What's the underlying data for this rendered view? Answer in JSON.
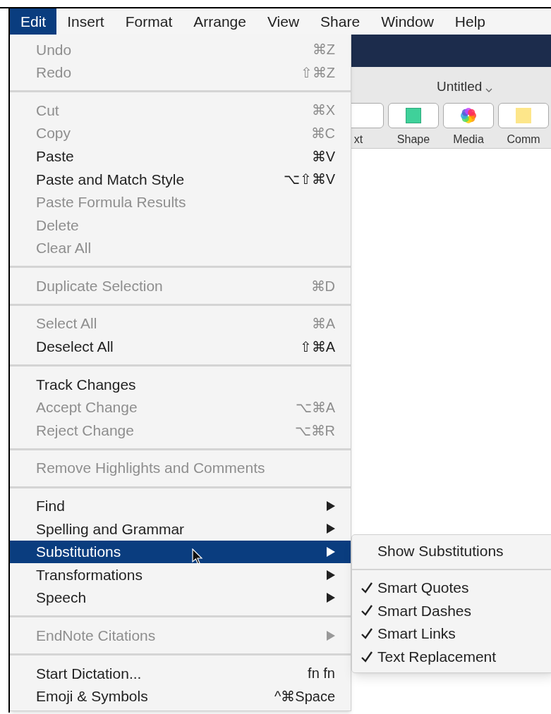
{
  "menubar": [
    {
      "label": "Edit",
      "selected": true
    },
    {
      "label": "Insert",
      "selected": false
    },
    {
      "label": "Format",
      "selected": false
    },
    {
      "label": "Arrange",
      "selected": false
    },
    {
      "label": "View",
      "selected": false
    },
    {
      "label": "Share",
      "selected": false
    },
    {
      "label": "Window",
      "selected": false
    },
    {
      "label": "Help",
      "selected": false
    }
  ],
  "window": {
    "title": "Untitled",
    "toolbar": [
      {
        "kind": "text",
        "label": "xt"
      },
      {
        "kind": "shape",
        "label": "Shape"
      },
      {
        "kind": "media",
        "label": "Media"
      },
      {
        "kind": "comment",
        "label": "Comm"
      }
    ]
  },
  "menu": {
    "sections": [
      [
        {
          "label": "Undo",
          "shortcut": "⌘Z",
          "disabled": true,
          "submenu": false,
          "selected": false
        },
        {
          "label": "Redo",
          "shortcut": "⇧⌘Z",
          "disabled": true,
          "submenu": false,
          "selected": false
        }
      ],
      [
        {
          "label": "Cut",
          "shortcut": "⌘X",
          "disabled": true,
          "submenu": false,
          "selected": false
        },
        {
          "label": "Copy",
          "shortcut": "⌘C",
          "disabled": true,
          "submenu": false,
          "selected": false
        },
        {
          "label": "Paste",
          "shortcut": "⌘V",
          "disabled": false,
          "submenu": false,
          "selected": false
        },
        {
          "label": "Paste and Match Style",
          "shortcut": "⌥⇧⌘V",
          "disabled": false,
          "submenu": false,
          "selected": false
        },
        {
          "label": "Paste Formula Results",
          "disabled": true,
          "submenu": false,
          "selected": false
        },
        {
          "label": "Delete",
          "disabled": true,
          "submenu": false,
          "selected": false
        },
        {
          "label": "Clear All",
          "disabled": true,
          "submenu": false,
          "selected": false
        }
      ],
      [
        {
          "label": "Duplicate Selection",
          "shortcut": "⌘D",
          "disabled": true,
          "submenu": false,
          "selected": false
        }
      ],
      [
        {
          "label": "Select All",
          "shortcut": "⌘A",
          "disabled": true,
          "submenu": false,
          "selected": false
        },
        {
          "label": "Deselect All",
          "shortcut": "⇧⌘A",
          "disabled": false,
          "submenu": false,
          "selected": false
        }
      ],
      [
        {
          "label": "Track Changes",
          "disabled": false,
          "submenu": false,
          "selected": false
        },
        {
          "label": "Accept Change",
          "shortcut": "⌥⌘A",
          "disabled": true,
          "submenu": false,
          "selected": false
        },
        {
          "label": "Reject Change",
          "shortcut": "⌥⌘R",
          "disabled": true,
          "submenu": false,
          "selected": false
        }
      ],
      [
        {
          "label": "Remove Highlights and Comments",
          "disabled": true,
          "submenu": false,
          "selected": false
        }
      ],
      [
        {
          "label": "Find",
          "disabled": false,
          "submenu": true,
          "selected": false
        },
        {
          "label": "Spelling and Grammar",
          "disabled": false,
          "submenu": true,
          "selected": false
        },
        {
          "label": "Substitutions",
          "disabled": false,
          "submenu": true,
          "selected": true
        },
        {
          "label": "Transformations",
          "disabled": false,
          "submenu": true,
          "selected": false
        },
        {
          "label": "Speech",
          "disabled": false,
          "submenu": true,
          "selected": false
        }
      ],
      [
        {
          "label": "EndNote Citations",
          "disabled": true,
          "submenu": true,
          "selected": false
        }
      ],
      [
        {
          "label": "Start Dictation...",
          "shortcut": "fn fn",
          "disabled": false,
          "submenu": false,
          "selected": false
        },
        {
          "label": "Emoji & Symbols",
          "shortcut": "^⌘Space",
          "disabled": false,
          "submenu": false,
          "selected": false
        }
      ]
    ]
  },
  "submenu": {
    "sections": [
      [
        {
          "label": "Show Substitutions",
          "checked": false
        }
      ],
      [
        {
          "label": "Smart Quotes",
          "checked": true
        },
        {
          "label": "Smart Dashes",
          "checked": true
        },
        {
          "label": "Smart Links",
          "checked": true
        },
        {
          "label": "Text Replacement",
          "checked": true
        }
      ]
    ]
  }
}
